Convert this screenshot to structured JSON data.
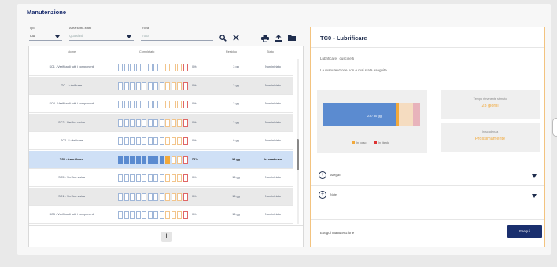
{
  "page": {
    "title": "Manutenzione"
  },
  "filters": {
    "tipo_label": "Tipo",
    "tipo_value": "Tutti",
    "area_label": "Area sotto-stato",
    "area_value": "Qualsiasi",
    "find_label": "Trova",
    "find_placeholder": "Trova"
  },
  "toolbar": {
    "search_icon": "search-icon",
    "clear_icon": "close-icon",
    "print_icon": "print-icon",
    "upload_icon": "upload-icon",
    "folder_icon": "folder-icon"
  },
  "table": {
    "columns": [
      "Nome",
      "Completato",
      "Residuo",
      "Stato"
    ],
    "rows": [
      {
        "name": "SC1 - Verifica di tutti i componenti",
        "pct": "0%",
        "residuo": "3 gg",
        "stato": "Non iniziato",
        "style": "normal",
        "fill": 0
      },
      {
        "name": "TC - Lubrificare",
        "pct": "0%",
        "residuo": "3 gg",
        "stato": "Non iniziato",
        "style": "alt",
        "fill": 0
      },
      {
        "name": "SC4 - Verifica di tutti i componenti",
        "pct": "0%",
        "residuo": "3 gg",
        "stato": "Non iniziato",
        "style": "normal",
        "fill": 0
      },
      {
        "name": "SC2 - Verifica visiva",
        "pct": "0%",
        "residuo": "3 gg",
        "stato": "Non iniziato",
        "style": "alt",
        "fill": 0
      },
      {
        "name": "SC2 - Lubrificare",
        "pct": "0%",
        "residuo": "9 gg",
        "stato": "Non iniziato",
        "style": "normal",
        "fill": 0
      },
      {
        "name": "TC0 - Lubrificare",
        "pct": "75%",
        "residuo": "16 gg",
        "stato": "In scadenza",
        "style": "sel",
        "fill": 0.75
      },
      {
        "name": "SC5 - Verifica visiva",
        "pct": "0%",
        "residuo": "16 gg",
        "stato": "Non iniziato",
        "style": "normal",
        "fill": 0
      },
      {
        "name": "SC1 - Verifica visiva",
        "pct": "0%",
        "residuo": "16 gg",
        "stato": "Non iniziato",
        "style": "alt",
        "fill": 0
      },
      {
        "name": "SC3 - Verifica di tutti i componenti",
        "pct": "0%",
        "residuo": "16 gg",
        "stato": "Non iniziato",
        "style": "normal",
        "fill": 0
      }
    ],
    "add_label": "+"
  },
  "detail": {
    "title": "TC0 - Lubrificare",
    "subtitle": "Lubrificare i cuscinetti",
    "note": "La manutenzione non è mai stata eseguita",
    "chart_value_label": "23 / 30 gg",
    "legend_a": "In corso",
    "legend_b": "In ritardo",
    "box1_label": "Tempo rimanente stimato",
    "box1_value": "23 giorni",
    "box2_label": "In scadenza",
    "box2_value": "Prossimamente",
    "accordion": [
      {
        "label": "Allegati"
      },
      {
        "label": "Note"
      }
    ],
    "footer_label": "Esegui Manutenzione",
    "footer_button": "Esegui",
    "colors": {
      "blue": "#5b8bd0",
      "orange": "#f2a93b",
      "peach": "#f5dcc0",
      "pink": "#e8b3bb"
    }
  }
}
